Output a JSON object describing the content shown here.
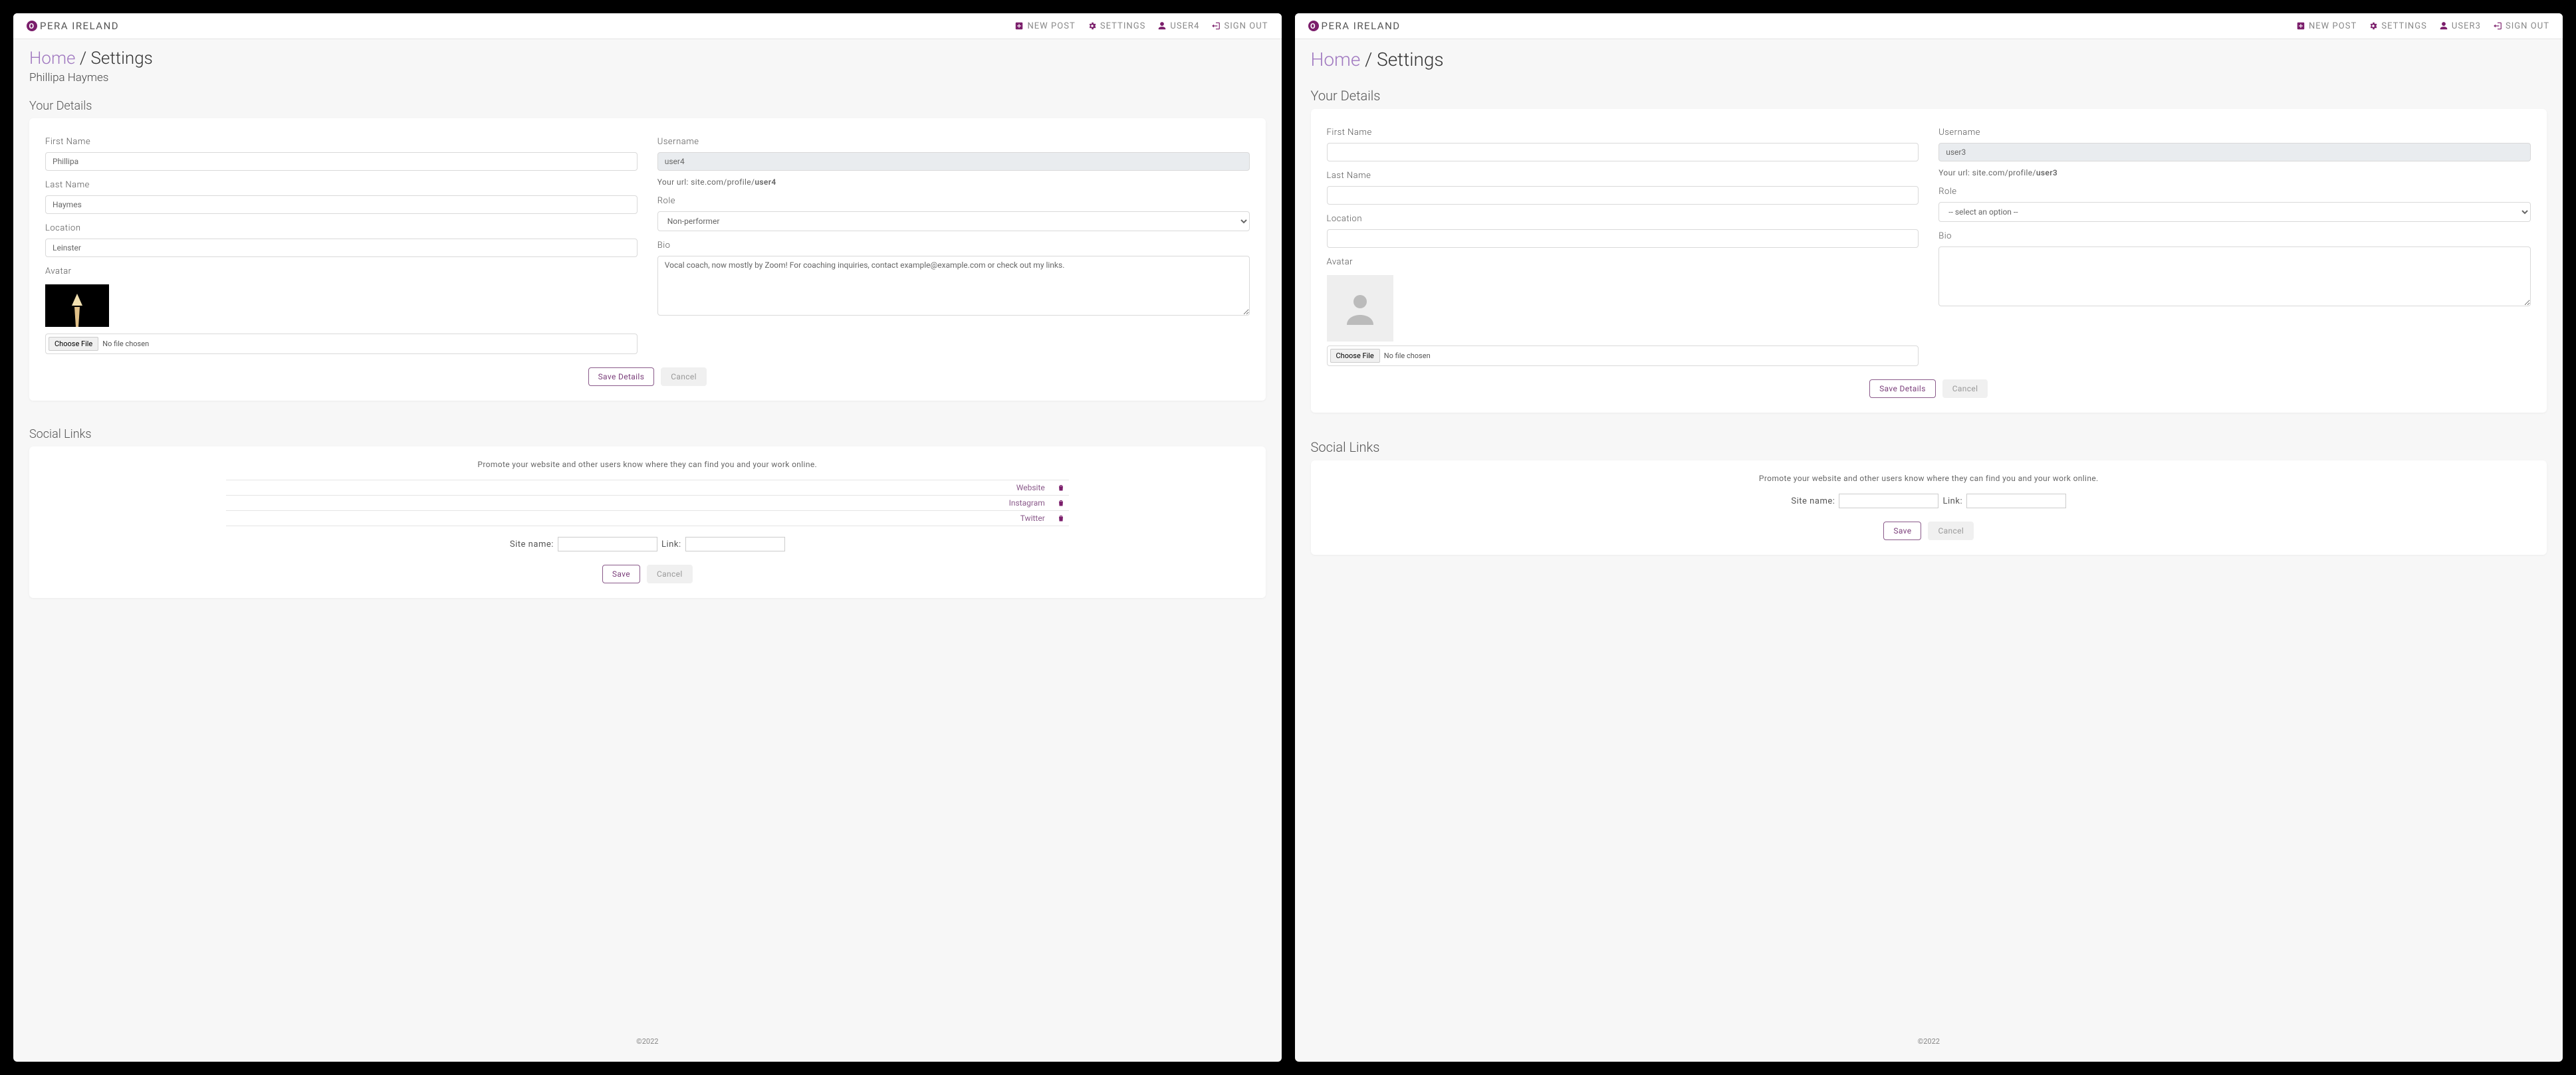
{
  "brand": {
    "name": "PERA IRELAND"
  },
  "nav": {
    "new_post": "NEW POST",
    "settings": "SETTINGS",
    "sign_out": "SIGN OUT"
  },
  "breadcrumb": {
    "home": "Home",
    "separator": " / ",
    "current": "Settings"
  },
  "sections": {
    "details": "Your Details",
    "social": "Social Links"
  },
  "labels": {
    "first_name": "First Name",
    "last_name": "Last Name",
    "location": "Location",
    "avatar": "Avatar",
    "username": "Username",
    "role": "Role",
    "bio": "Bio",
    "choose_file": "Choose File",
    "no_file": "No file chosen",
    "save_details": "Save Details",
    "cancel": "Cancel",
    "save": "Save",
    "site_name": "Site name:",
    "link": "Link:",
    "url_prefix": "Your url: site.com/profile/"
  },
  "social_promo": "Promote your website and other users know where they can find you and your work online.",
  "footer": "©2022",
  "paneA": {
    "nav_user": "USER4",
    "subname": "Phillipa Haymes",
    "first_name": "Phillipa",
    "last_name": "Haymes",
    "location": "Leinster",
    "username": "user4",
    "url_suffix": "user4",
    "role": "Non-performer",
    "bio": "Vocal coach, now mostly by Zoom! For coaching inquiries, contact example@example.com or check out my links.",
    "social_links": [
      {
        "name": "Website"
      },
      {
        "name": "Instagram"
      },
      {
        "name": "Twitter"
      }
    ]
  },
  "paneB": {
    "nav_user": "USER3",
    "first_name": "",
    "last_name": "",
    "location": "",
    "username": "user3",
    "url_suffix": "user3",
    "role_placeholder": "-- select an option --",
    "bio": "",
    "social_links": []
  }
}
